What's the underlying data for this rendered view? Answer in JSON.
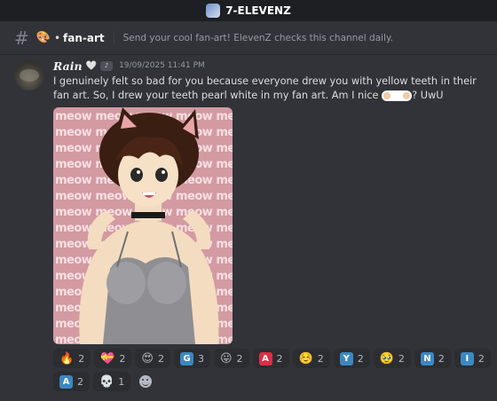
{
  "window": {
    "title": "7-ELEVENZ"
  },
  "channel": {
    "icon": "palette-icon",
    "name": "fan-art",
    "topic": "Send your cool fan-art! ElevenZ checks this channel daily."
  },
  "message": {
    "author": "Rain",
    "badges": [
      "heart-icon",
      "badge-icon"
    ],
    "timestamp": "19/09/2025 11:41 PM",
    "text_line1": "I genuinely felt so bad for you because everyone drew you with yellow teeth in their fan art.",
    "text_line2_a": "So, I drew your teeth pearl white in my fan art. Am I nice ",
    "text_line2_b": "? UwU",
    "attachment": {
      "type": "image",
      "description": "anime catgirl fan art on pink meow-pattern background",
      "background_text": "meow"
    }
  },
  "reactions": [
    {
      "emoji": "🔥",
      "count": "2"
    },
    {
      "emoji": "💝",
      "count": "2"
    },
    {
      "emoji": "😍",
      "count": "2"
    },
    {
      "tile": "G",
      "color": "#3b88c3",
      "count": "3"
    },
    {
      "emoji": "😛",
      "count": "2"
    },
    {
      "tile": "A",
      "color": "#dd2e44",
      "count": "2"
    },
    {
      "emoji": "☺️",
      "count": "2"
    },
    {
      "tile": "Y",
      "color": "#3b88c3",
      "count": "2"
    },
    {
      "emoji": "🥹",
      "count": "2"
    },
    {
      "tile": "N",
      "color": "#3b88c3",
      "count": "2"
    },
    {
      "tile": "I",
      "color": "#3b88c3",
      "count": "2"
    },
    {
      "tile": "A",
      "color": "#3b88c3",
      "count": "2"
    },
    {
      "emoji": "💀",
      "count": "1"
    }
  ],
  "colors": {
    "background": "#313338",
    "titlebar": "#1e1f22",
    "reaction_bg": "#2b2d31",
    "text": "#dbdee1",
    "muted": "#949ba4"
  }
}
